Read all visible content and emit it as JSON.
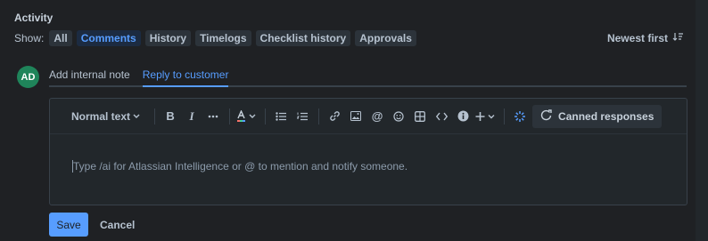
{
  "activity": {
    "heading": "Activity",
    "show_label": "Show:",
    "filters": [
      {
        "label": "All",
        "active": false
      },
      {
        "label": "Comments",
        "active": true
      },
      {
        "label": "History",
        "active": false
      },
      {
        "label": "Timelogs",
        "active": false
      },
      {
        "label": "Checklist history",
        "active": false
      },
      {
        "label": "Approvals",
        "active": false
      }
    ],
    "sort_label": "Newest first"
  },
  "user": {
    "initials": "AD"
  },
  "composer": {
    "tabs": [
      {
        "label": "Add internal note",
        "active": false
      },
      {
        "label": "Reply to customer",
        "active": true
      }
    ],
    "toolbar": {
      "text_style": "Normal text",
      "canned_responses": "Canned responses"
    },
    "placeholder": "Type /ai for Atlassian Intelligence or @ to mention and notify someone.",
    "save_label": "Save",
    "cancel_label": "Cancel"
  },
  "colors": {
    "accent": "#579dff",
    "avatar": "#1f845a",
    "background": "#1f2124"
  }
}
